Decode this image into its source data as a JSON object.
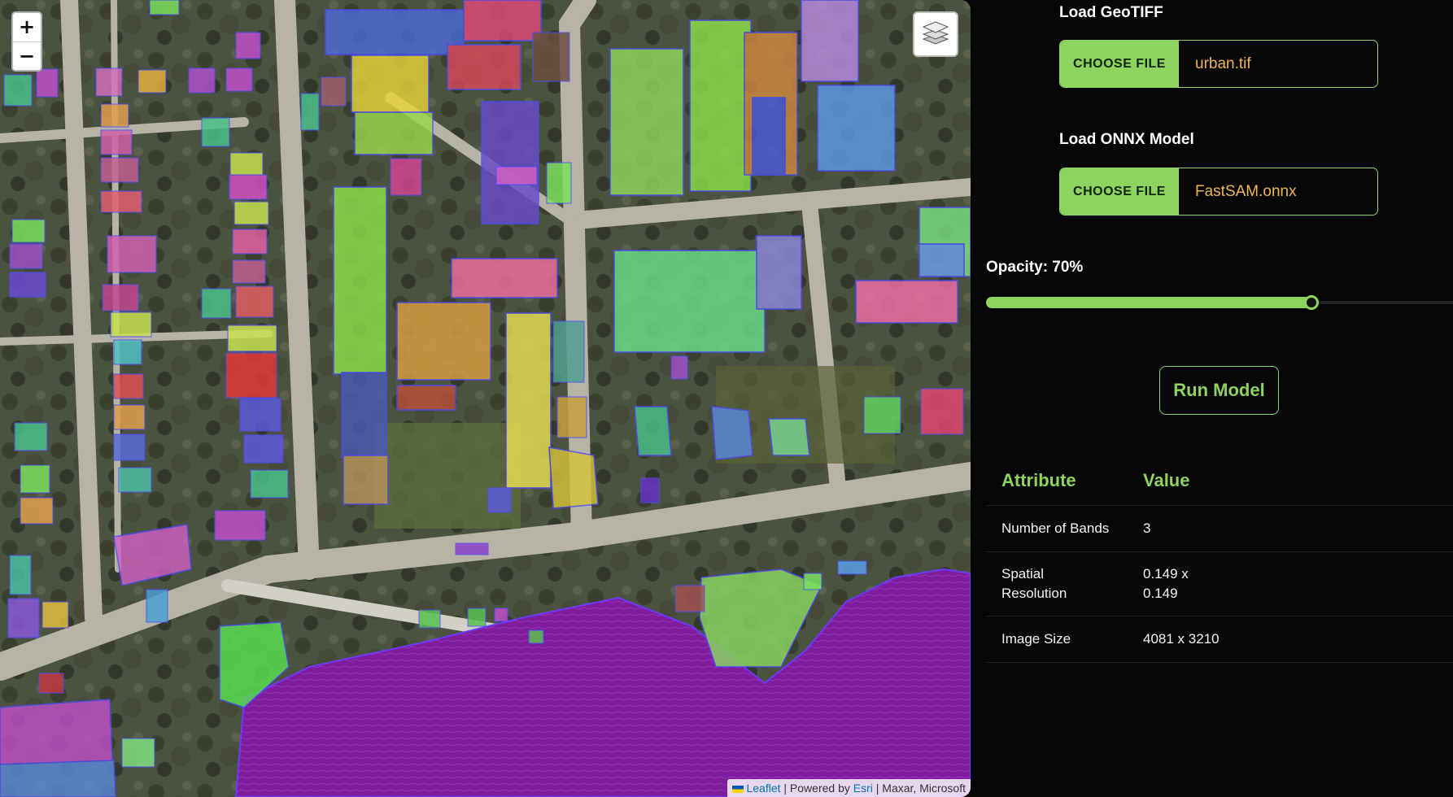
{
  "map": {
    "zoom_in_label": "+",
    "zoom_out_label": "−",
    "layers_icon": "layers-stack-icon",
    "attribution": {
      "leaflet": "Leaflet",
      "sep1": " | Powered by ",
      "esri": "Esri",
      "sep2": " | Maxar, Microsoft"
    }
  },
  "panel": {
    "geotiff": {
      "label": "Load GeoTIFF",
      "button": "CHOOSE FILE",
      "filename": "urban.tif"
    },
    "onnx": {
      "label": "Load ONNX Model",
      "button": "CHOOSE FILE",
      "filename": "FastSAM.onnx"
    },
    "opacity": {
      "label": "Opacity: 70%",
      "value": 0.7
    },
    "run_button": "Run Model",
    "table": {
      "headers": [
        "Attribute",
        "Value"
      ],
      "rows": [
        {
          "attribute": "Number of Bands",
          "value": "3"
        },
        {
          "attribute": "Spatial Resolution",
          "value": "0.149 x 0.149"
        },
        {
          "attribute": "Image Size",
          "value": "4081 x 3210"
        }
      ]
    }
  },
  "colors": {
    "accent": "#8dd35f",
    "filename": "#f0b45a",
    "background": "#060606",
    "water_mask": "#8a20a8"
  }
}
